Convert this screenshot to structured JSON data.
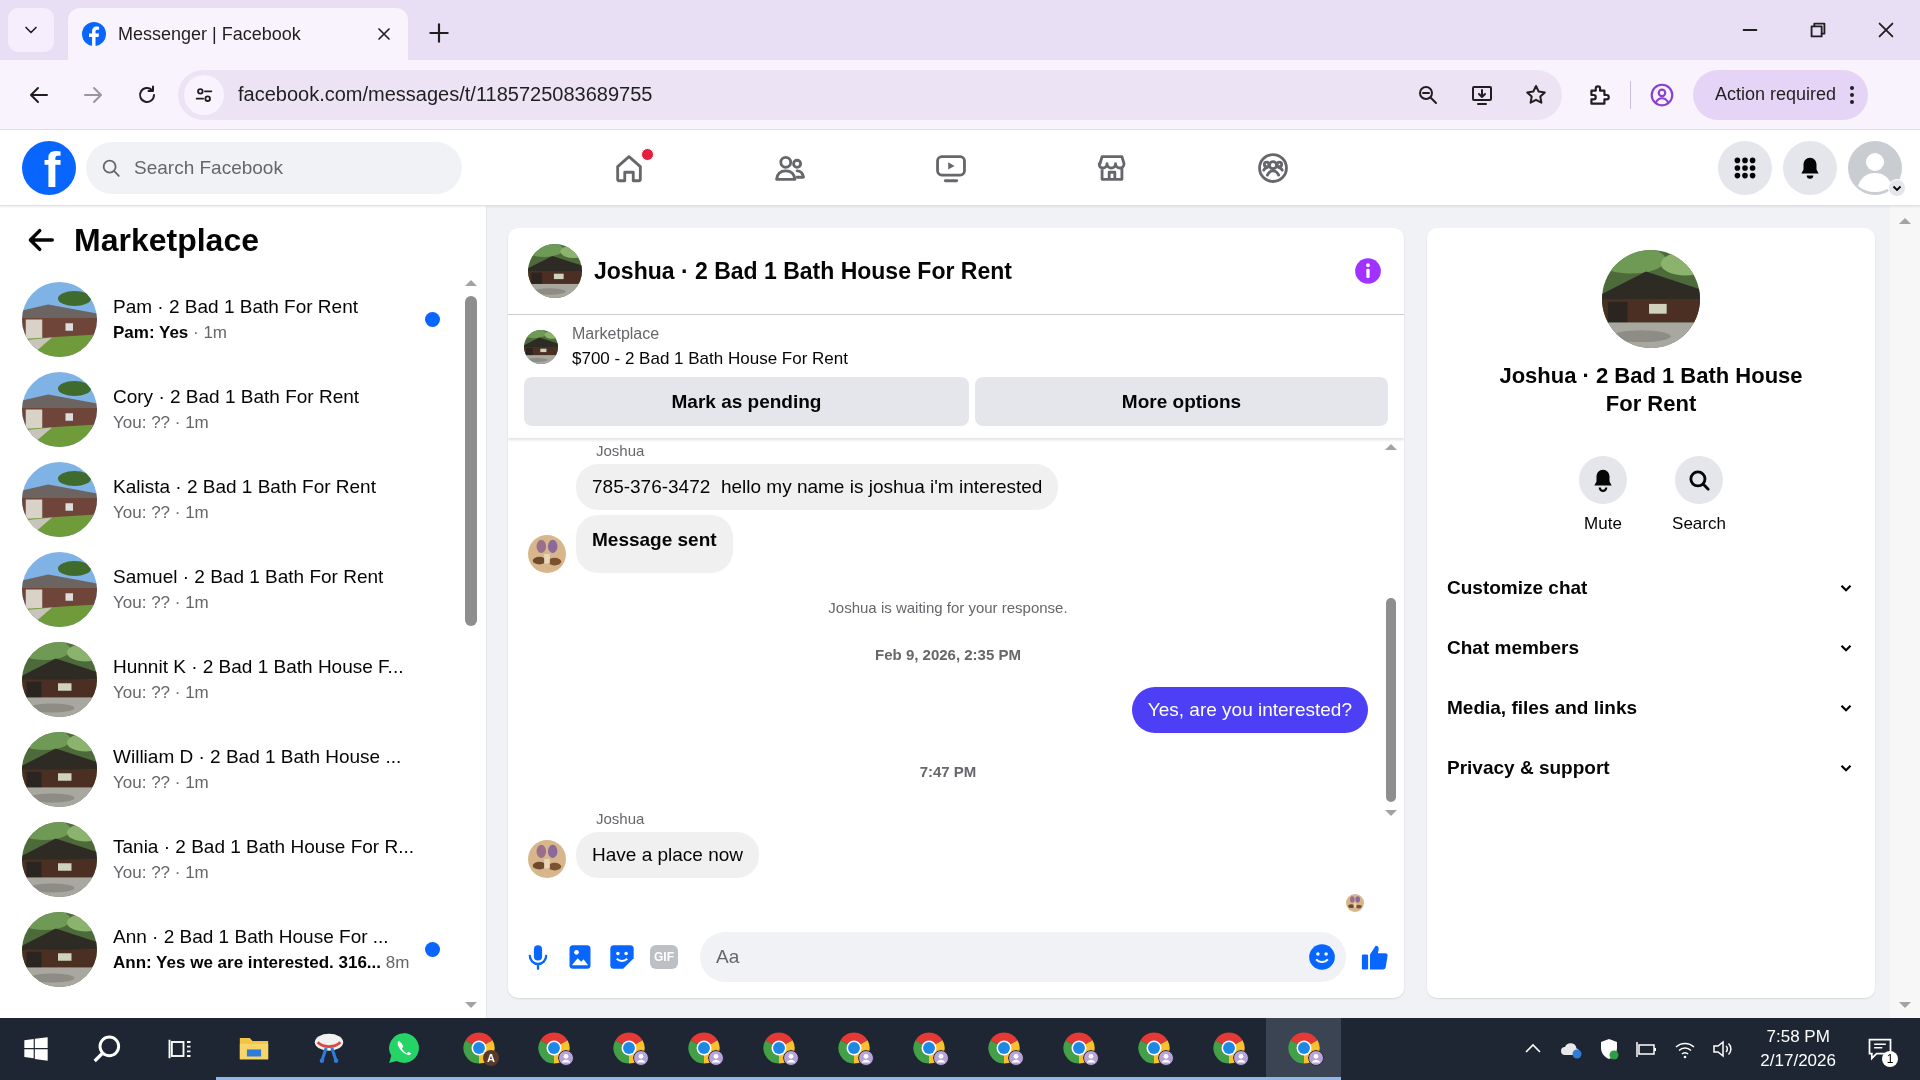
{
  "browser": {
    "tabs": [
      {
        "title": "Messenger | Facebook",
        "selected": true
      }
    ],
    "url": "facebook.com/messages/t/1185725083689755",
    "action_button": "Action required"
  },
  "header": {
    "logo_text": "f",
    "search": {
      "placeholder": "Search Facebook"
    },
    "nav": [
      {
        "kind": "home",
        "alert": true
      },
      {
        "kind": "friends",
        "alert": false
      },
      {
        "kind": "video",
        "alert": false
      },
      {
        "kind": "marketplace",
        "alert": false
      },
      {
        "kind": "groups",
        "alert": false
      }
    ]
  },
  "sidebar": {
    "title": "Marketplace",
    "conversations": [
      {
        "title": "Pam · 2 Bad 1 Bath For Rent",
        "preview": "Pam: Yes",
        "time": "· 1m",
        "unread": true
      },
      {
        "title": "Cory · 2 Bad 1 Bath For Rent",
        "preview": "You: ??",
        "time": "· 1m",
        "unread": false
      },
      {
        "title": "Kalista · 2 Bad 1 Bath For Rent",
        "preview": "You: ??",
        "time": "· 1m",
        "unread": false
      },
      {
        "title": "Samuel · 2 Bad 1 Bath For Rent",
        "preview": "You: ??",
        "time": "· 1m",
        "unread": false
      },
      {
        "title": "Hunnit K · 2 Bad 1 Bath House F...",
        "preview": "You: ??",
        "time": "· 1m",
        "unread": false
      },
      {
        "title": "William D · 2 Bad 1 Bath House ...",
        "preview": "You: ??",
        "time": "· 1m",
        "unread": false
      },
      {
        "title": "Tania · 2 Bad 1 Bath House For R...",
        "preview": "You: ??",
        "time": "· 1m",
        "unread": false
      },
      {
        "title": "Ann · 2 Bad 1 Bath House For ...",
        "preview": "Ann: Yes we are interested. 316...",
        "time": "8m",
        "unread": true
      }
    ]
  },
  "chat": {
    "title": "Joshua · 2 Bad 1 Bath House For Rent",
    "listing": {
      "label": "Marketplace",
      "title": "$700 - 2 Bad 1 Bath House For Rent"
    },
    "actions": [
      "Mark as pending",
      "More options"
    ],
    "messages": [
      {
        "kind": "sender",
        "text": "Joshua"
      },
      {
        "kind": "incoming",
        "text": "785-376-3472  hello my name is joshua i'm interested",
        "avatar": false,
        "emphasis": false
      },
      {
        "kind": "incoming",
        "text": "Message sent",
        "avatar": true,
        "emphasis": true
      },
      {
        "kind": "system",
        "text": "Joshua is waiting for your response."
      },
      {
        "kind": "timestamp",
        "text": "Feb 9, 2026, 2:35 PM"
      },
      {
        "kind": "outgoing",
        "text": "Yes, are you interested?"
      },
      {
        "kind": "timestamp",
        "text": "7:47 PM"
      },
      {
        "kind": "sender",
        "text": "Joshua"
      },
      {
        "kind": "incoming",
        "text": "Have a place now",
        "avatar": true,
        "emphasis": false
      },
      {
        "kind": "receipt"
      }
    ],
    "composer": {
      "gif_label": "GIF",
      "placeholder": "Aa"
    }
  },
  "info": {
    "name": "Joshua · 2 Bad 1 Bath House For Rent",
    "actions": [
      {
        "kind": "mute",
        "label": "Mute"
      },
      {
        "kind": "search",
        "label": "Search"
      }
    ],
    "sections": [
      {
        "label": "Customize chat",
        "expanded": false
      },
      {
        "label": "Chat members",
        "expanded": false
      },
      {
        "label": "Media, files and links",
        "expanded": false
      },
      {
        "label": "Privacy & support",
        "expanded": false
      }
    ]
  },
  "taskbar": {
    "apps": [
      {
        "kind": "explorer",
        "active": false
      },
      {
        "kind": "snipping",
        "active": false
      },
      {
        "kind": "whatsapp",
        "active": false
      },
      {
        "kind": "chrome",
        "badge": "A",
        "active": false
      },
      {
        "kind": "chrome",
        "active": false
      },
      {
        "kind": "chrome",
        "active": false
      },
      {
        "kind": "chrome",
        "active": false
      },
      {
        "kind": "chrome",
        "active": false
      },
      {
        "kind": "chrome",
        "active": false
      },
      {
        "kind": "chrome",
        "active": false
      },
      {
        "kind": "chrome",
        "active": false
      },
      {
        "kind": "chrome",
        "active": false
      },
      {
        "kind": "chrome",
        "active": false
      },
      {
        "kind": "chrome",
        "active": false
      },
      {
        "kind": "chrome",
        "active": true
      }
    ],
    "time": "7:58 PM",
    "date": "2/17/2026",
    "notifications": "1"
  }
}
